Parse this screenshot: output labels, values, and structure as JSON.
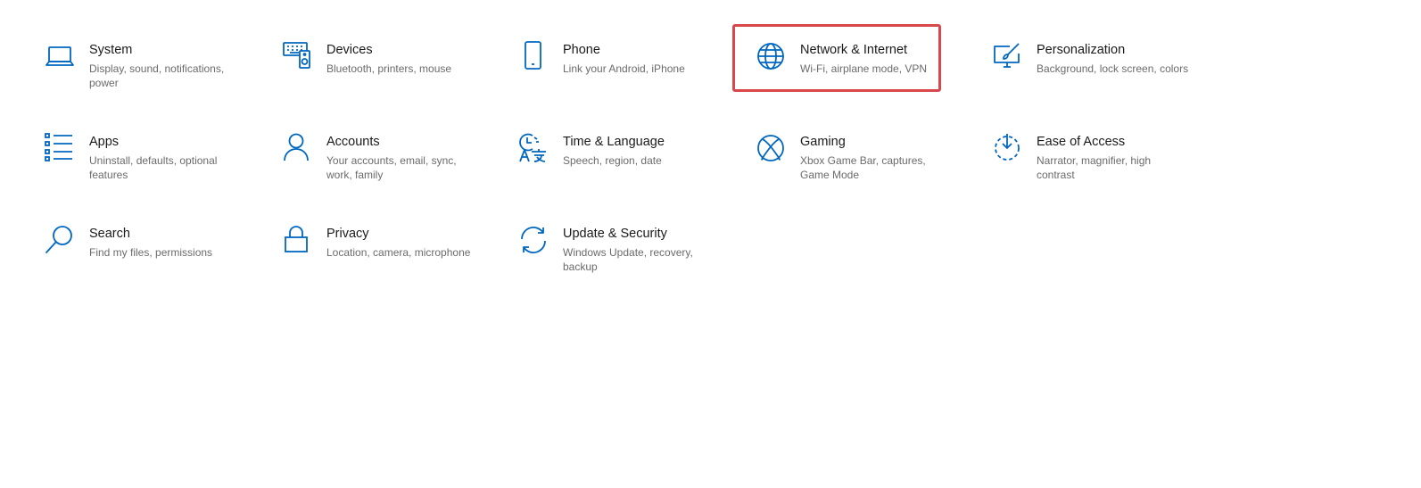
{
  "accent_color": "#0067c0",
  "highlight_color": "#d9474b",
  "settings_tiles": [
    {
      "id": "system",
      "icon": "laptop-icon",
      "title": "System",
      "desc": "Display, sound, notifications, power"
    },
    {
      "id": "devices",
      "icon": "devices-icon",
      "title": "Devices",
      "desc": "Bluetooth, printers, mouse"
    },
    {
      "id": "phone",
      "icon": "phone-icon",
      "title": "Phone",
      "desc": "Link your Android, iPhone"
    },
    {
      "id": "network",
      "icon": "globe-icon",
      "title": "Network & Internet",
      "desc": "Wi-Fi, airplane mode, VPN"
    },
    {
      "id": "personalization",
      "icon": "paint-monitor-icon",
      "title": "Personalization",
      "desc": "Background, lock screen, colors"
    },
    {
      "id": "apps",
      "icon": "apps-list-icon",
      "title": "Apps",
      "desc": "Uninstall, defaults, optional features"
    },
    {
      "id": "accounts",
      "icon": "person-icon",
      "title": "Accounts",
      "desc": "Your accounts, email, sync, work, family"
    },
    {
      "id": "time-language",
      "icon": "time-language-icon",
      "title": "Time & Language",
      "desc": "Speech, region, date"
    },
    {
      "id": "gaming",
      "icon": "xbox-icon",
      "title": "Gaming",
      "desc": "Xbox Game Bar, captures, Game Mode"
    },
    {
      "id": "ease-of-access",
      "icon": "ease-of-access-icon",
      "title": "Ease of Access",
      "desc": "Narrator, magnifier, high contrast"
    },
    {
      "id": "search",
      "icon": "search-icon",
      "title": "Search",
      "desc": "Find my files, permissions"
    },
    {
      "id": "privacy",
      "icon": "lock-icon",
      "title": "Privacy",
      "desc": "Location, camera, microphone"
    },
    {
      "id": "update-security",
      "icon": "sync-icon",
      "title": "Update & Security",
      "desc": "Windows Update, recovery, backup"
    }
  ]
}
